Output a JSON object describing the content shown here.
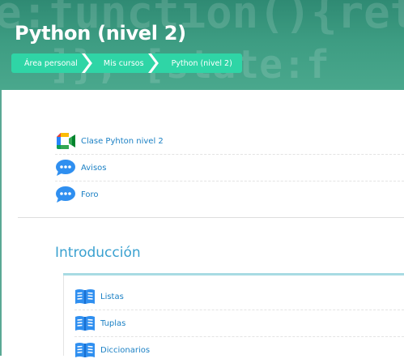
{
  "course": {
    "title": "Python (nivel 2)"
  },
  "breadcrumb": [
    {
      "label": "Área personal"
    },
    {
      "label": "Mis cursos"
    },
    {
      "label": "Python (nivel 2)"
    }
  ],
  "general_activities": [
    {
      "label": "Clase Pyhton nivel 2",
      "icon": "google-meet-icon"
    },
    {
      "label": "Avisos",
      "icon": "forum-chat-icon"
    },
    {
      "label": "Foro",
      "icon": "forum-chat-icon"
    }
  ],
  "section": {
    "title": "Introducción",
    "activities": [
      {
        "label": "Listas",
        "icon": "book-icon"
      },
      {
        "label": "Tuplas",
        "icon": "book-icon"
      },
      {
        "label": "Diccionarios",
        "icon": "book-icon"
      }
    ]
  },
  "colors": {
    "banner": "#3d9c82",
    "breadcrumb": "#2fd5a6",
    "link": "#1b80c4",
    "section_title": "#3aa1d0",
    "section_bar": "#a8dbe3"
  }
}
